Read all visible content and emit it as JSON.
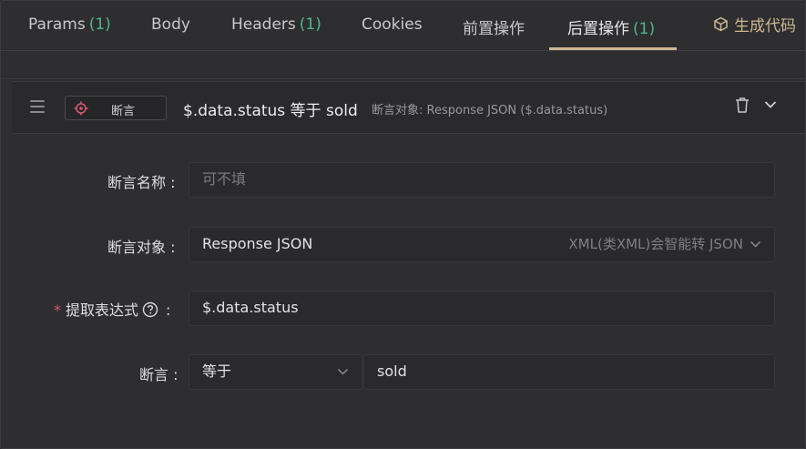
{
  "tabs": [
    {
      "label": "Params",
      "count": "(1)"
    },
    {
      "label": "Body",
      "count": ""
    },
    {
      "label": "Headers",
      "count": "(1)"
    },
    {
      "label": "Cookies",
      "count": ""
    },
    {
      "label": "前置操作",
      "count": ""
    },
    {
      "label": "后置操作",
      "count": "(1)"
    }
  ],
  "generate_code_label": "生成代码",
  "assertion": {
    "type_label": "断言",
    "title": "$.data.status 等于 sold",
    "subtitle": "断言对象: Response JSON ($.data.status)"
  },
  "form": {
    "name_label": "断言名称 :",
    "name_placeholder": "可不填",
    "target_label": "断言对象 :",
    "target_value": "Response JSON",
    "target_hint": "XML(类XML)会智能转 JSON",
    "expression_required": "*",
    "expression_label": "提取表达式",
    "expression_colon": ":",
    "expression_value": "$.data.status",
    "assert_label": "断言 :",
    "operator_value": "等于",
    "expected_value": "sold"
  },
  "colors": {
    "accent": "#cdb891",
    "count_green": "#4fb88a",
    "required_red": "#d25a6c"
  }
}
